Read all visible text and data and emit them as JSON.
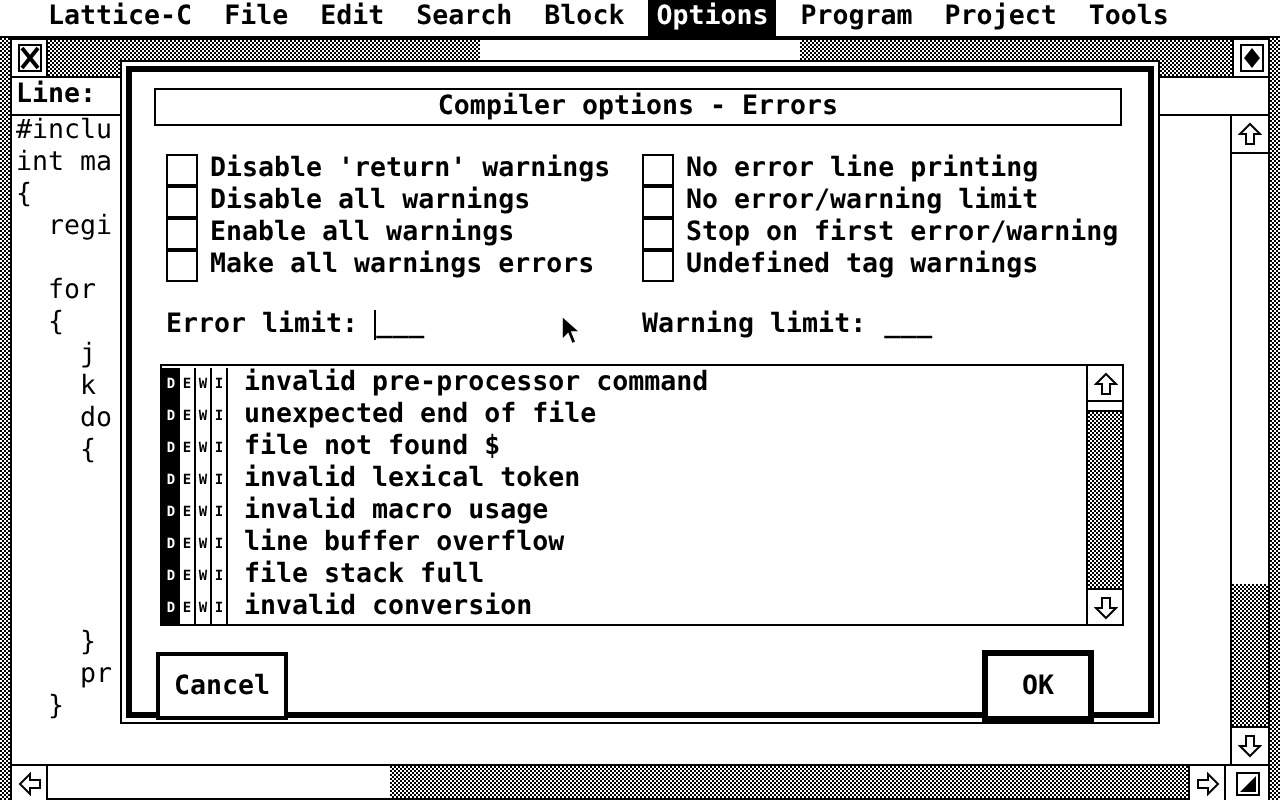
{
  "menu": [
    {
      "label": "Lattice-C",
      "selected": false
    },
    {
      "label": "File",
      "selected": false
    },
    {
      "label": "Edit",
      "selected": false
    },
    {
      "label": "Search",
      "selected": false
    },
    {
      "label": "Block",
      "selected": false
    },
    {
      "label": "Options",
      "selected": true
    },
    {
      "label": "Program",
      "selected": false
    },
    {
      "label": "Project",
      "selected": false
    },
    {
      "label": "Tools",
      "selected": false
    }
  ],
  "window": {
    "line_label": "Line:",
    "code_lines": [
      {
        "kind": "code",
        "text": "#inclu"
      },
      {
        "kind": "code",
        "text": "int ma"
      },
      {
        "kind": "code",
        "text": "{"
      },
      {
        "kind": "code",
        "text": "  regi"
      },
      {
        "kind": "blank"
      },
      {
        "kind": "code",
        "text": "  for"
      },
      {
        "kind": "code",
        "text": "  {"
      },
      {
        "kind": "code",
        "text": "    j"
      },
      {
        "kind": "code",
        "text": "    k"
      },
      {
        "kind": "code",
        "text": "    do"
      },
      {
        "kind": "code",
        "text": "    {"
      },
      {
        "kind": "blank"
      },
      {
        "kind": "blank"
      },
      {
        "kind": "blank"
      },
      {
        "kind": "blank"
      },
      {
        "kind": "blank"
      },
      {
        "kind": "code",
        "text": "    }"
      },
      {
        "kind": "code",
        "text": "    pr"
      },
      {
        "kind": "code",
        "text": "  }"
      }
    ]
  },
  "dialog": {
    "title": "Compiler options - Errors",
    "options": [
      {
        "label": "Disable 'return' warnings",
        "checked": false
      },
      {
        "label": "Disable all warnings",
        "checked": false
      },
      {
        "label": "Enable all warnings",
        "checked": false
      },
      {
        "label": "Make all warnings errors",
        "checked": false
      },
      {
        "label": "No error line printing",
        "checked": false
      },
      {
        "label": "No error/warning limit",
        "checked": false
      },
      {
        "label": "Stop on first error/warning",
        "checked": false
      },
      {
        "label": "Undefined tag warnings",
        "checked": false
      }
    ],
    "limits": [
      {
        "label": "Error limit:",
        "template": "___",
        "focused": true
      },
      {
        "label": "Warning limit:",
        "template": "___",
        "focused": false
      }
    ],
    "messages": [
      {
        "text": "invalid pre-processor command",
        "flags": [
          {
            "letter": "D",
            "selected": true
          },
          {
            "letter": "E",
            "selected": false
          },
          {
            "letter": "W",
            "selected": false
          },
          {
            "letter": "I",
            "selected": false
          }
        ]
      },
      {
        "text": "unexpected end of file",
        "flags": [
          {
            "letter": "D",
            "selected": true
          },
          {
            "letter": "E",
            "selected": false
          },
          {
            "letter": "W",
            "selected": false
          },
          {
            "letter": "I",
            "selected": false
          }
        ]
      },
      {
        "text": "file not found $",
        "flags": [
          {
            "letter": "D",
            "selected": true
          },
          {
            "letter": "E",
            "selected": false
          },
          {
            "letter": "W",
            "selected": false
          },
          {
            "letter": "I",
            "selected": false
          }
        ]
      },
      {
        "text": "invalid lexical token",
        "flags": [
          {
            "letter": "D",
            "selected": true
          },
          {
            "letter": "E",
            "selected": false
          },
          {
            "letter": "W",
            "selected": false
          },
          {
            "letter": "I",
            "selected": false
          }
        ]
      },
      {
        "text": "invalid macro usage",
        "flags": [
          {
            "letter": "D",
            "selected": true
          },
          {
            "letter": "E",
            "selected": false
          },
          {
            "letter": "W",
            "selected": false
          },
          {
            "letter": "I",
            "selected": false
          }
        ]
      },
      {
        "text": "line buffer overflow",
        "flags": [
          {
            "letter": "D",
            "selected": true
          },
          {
            "letter": "E",
            "selected": false
          },
          {
            "letter": "W",
            "selected": false
          },
          {
            "letter": "I",
            "selected": false
          }
        ]
      },
      {
        "text": "file stack full",
        "flags": [
          {
            "letter": "D",
            "selected": true
          },
          {
            "letter": "E",
            "selected": false
          },
          {
            "letter": "W",
            "selected": false
          },
          {
            "letter": "I",
            "selected": false
          }
        ]
      },
      {
        "text": "invalid conversion",
        "flags": [
          {
            "letter": "D",
            "selected": true
          },
          {
            "letter": "E",
            "selected": false
          },
          {
            "letter": "W",
            "selected": false
          },
          {
            "letter": "I",
            "selected": false
          }
        ]
      }
    ],
    "buttons": [
      {
        "label": "Cancel",
        "default": false
      },
      {
        "label": "OK",
        "default": true
      }
    ]
  }
}
